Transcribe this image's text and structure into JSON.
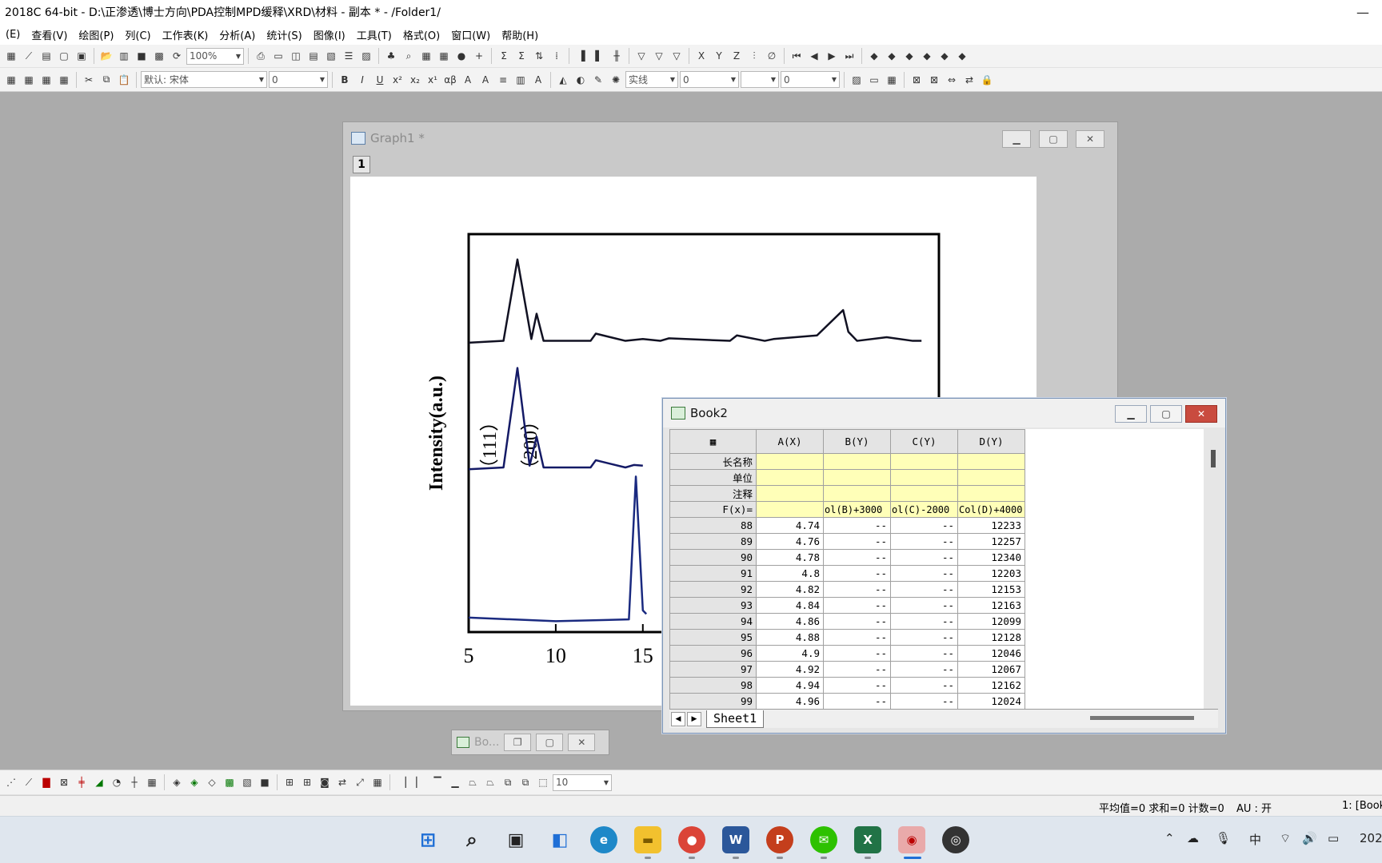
{
  "app": {
    "title": "2018C 64-bit - D:\\正渗透\\博士方向\\PDA控制MPD缓释\\XRD\\材料 - 副本 * - /Folder1/",
    "minimize_glyph": "—"
  },
  "menu": [
    "(E)",
    "查看(V)",
    "绘图(P)",
    "列(C)",
    "工作表(K)",
    "分析(A)",
    "统计(S)",
    "图像(I)",
    "工具(T)",
    "格式(O)",
    "窗口(W)",
    "帮助(H)"
  ],
  "toolbar": {
    "zoom": "100%",
    "font_name": "默认: 宋体",
    "font_size": "0",
    "line_style": "实线",
    "line_width": "0",
    "fill_value": "0",
    "bottom_size": "10"
  },
  "graph_window": {
    "title": "Graph1 *",
    "layer": "1"
  },
  "chart_data": {
    "type": "line",
    "ylabel": "Intensity(a.u.)",
    "x_ticks": [
      "5",
      "10",
      "15"
    ],
    "xlim": [
      5,
      32
    ],
    "annotations": [
      "（111）",
      "（200）"
    ],
    "series": [
      {
        "x": [
          5,
          7,
          7.8,
          8.6,
          8.9,
          9.3,
          12,
          12.3,
          14,
          15,
          16,
          16.5,
          20,
          20.4,
          22,
          22.5,
          25,
          26.5,
          26.8,
          27.3,
          29,
          30.5,
          31
        ],
        "y": [
          8.0,
          8.05,
          10.3,
          8.1,
          8.8,
          8.05,
          8.05,
          8.25,
          8.05,
          8.1,
          8.05,
          8.12,
          8.05,
          8.2,
          8.05,
          8.1,
          8.2,
          8.9,
          8.3,
          8.05,
          8.15,
          8.05,
          8.05
        ]
      },
      {
        "x": [
          5,
          7,
          7.8,
          8.5,
          8.9,
          9.3,
          12,
          12.3,
          14,
          14.5,
          15
        ],
        "y": [
          4.5,
          4.55,
          7.3,
          4.6,
          5.4,
          4.55,
          4.55,
          4.75,
          4.55,
          4.62,
          4.6
        ]
      },
      {
        "x": [
          5,
          10,
          14.2,
          14.6,
          15.0,
          15.2
        ],
        "y": [
          0.4,
          0.3,
          0.35,
          4.3,
          0.6,
          0.5
        ]
      }
    ]
  },
  "book": {
    "title": "Book2",
    "columns": [
      "A(X)",
      "B(Y)",
      "C(Y)",
      "D(Y)"
    ],
    "meta_rows": [
      "长名称",
      "单位",
      "注释"
    ],
    "fx_label": "F(x)=",
    "fx_values": [
      "",
      "ol(B)+3000",
      "ol(C)-2000",
      "Col(D)+4000"
    ],
    "rows": [
      {
        "n": "88",
        "a": "4.74",
        "b": "--",
        "c": "--",
        "d": "12233"
      },
      {
        "n": "89",
        "a": "4.76",
        "b": "--",
        "c": "--",
        "d": "12257"
      },
      {
        "n": "90",
        "a": "4.78",
        "b": "--",
        "c": "--",
        "d": "12340"
      },
      {
        "n": "91",
        "a": "4.8",
        "b": "--",
        "c": "--",
        "d": "12203"
      },
      {
        "n": "92",
        "a": "4.82",
        "b": "--",
        "c": "--",
        "d": "12153"
      },
      {
        "n": "93",
        "a": "4.84",
        "b": "--",
        "c": "--",
        "d": "12163"
      },
      {
        "n": "94",
        "a": "4.86",
        "b": "--",
        "c": "--",
        "d": "12099"
      },
      {
        "n": "95",
        "a": "4.88",
        "b": "--",
        "c": "--",
        "d": "12128"
      },
      {
        "n": "96",
        "a": "4.9",
        "b": "--",
        "c": "--",
        "d": "12046"
      },
      {
        "n": "97",
        "a": "4.92",
        "b": "--",
        "c": "--",
        "d": "12067"
      },
      {
        "n": "98",
        "a": "4.94",
        "b": "--",
        "c": "--",
        "d": "12162"
      },
      {
        "n": "99",
        "a": "4.96",
        "b": "--",
        "c": "--",
        "d": "12024"
      }
    ],
    "sheet_tab": "Sheet1"
  },
  "mini_book": {
    "title": "Bo..."
  },
  "status": {
    "stats": "平均值=0 求和=0 计数=0",
    "au": "AU : 开",
    "book_ref": "1: [Book"
  },
  "tray": {
    "ime": "中",
    "year": "202"
  },
  "taskbar_apps": [
    "start",
    "search",
    "task-view",
    "widgets",
    "edge",
    "explorer",
    "chrome",
    "word",
    "powerpoint",
    "wechat",
    "excel",
    "origin",
    "obs"
  ]
}
